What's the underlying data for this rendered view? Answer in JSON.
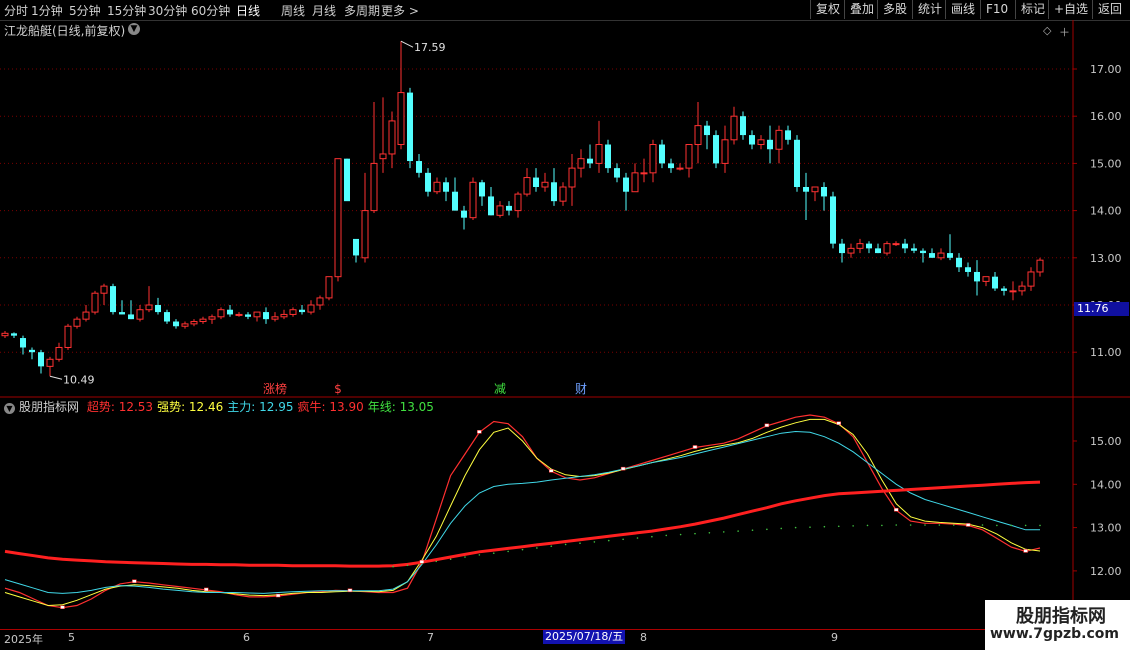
{
  "period_tabs": [
    "分时",
    "1分钟",
    "5分钟",
    "15分钟",
    "30分钟",
    "60分钟",
    "日线",
    "周线",
    "月线",
    "多周期",
    "更多 >"
  ],
  "active_period": "日线",
  "toolbar": [
    "复权",
    "叠加",
    "多股",
    "统计",
    "画线",
    "F10",
    "标记",
    "+自选",
    "返回"
  ],
  "chart_title": "江龙船艇(日线,前复权)",
  "main_axis_ticks": [
    "17.00",
    "16.00",
    "15.00",
    "14.00",
    "13.00",
    "12.00",
    "11.00"
  ],
  "current_price": "11.76",
  "high_label": "17.59",
  "low_label": "10.49",
  "event_markers": [
    {
      "label": "涨榜",
      "color": "#ff4040"
    },
    {
      "label": "$",
      "color": "#ff4040"
    },
    {
      "label": "减",
      "color": "#40e040"
    },
    {
      "label": "财",
      "color": "#6fa0ff"
    }
  ],
  "indicator": {
    "name": "股朋指标网",
    "items": [
      {
        "label": "超势: 12.53",
        "color": "#ff3030"
      },
      {
        "label": "强势: 12.46",
        "color": "#ffff40"
      },
      {
        "label": "主力: 12.95",
        "color": "#40d8e8"
      },
      {
        "label": "疯牛: 13.90",
        "color": "#ff3030"
      },
      {
        "label": "年线: 13.05",
        "color": "#40e040"
      }
    ]
  },
  "ind_axis_ticks": [
    "15.00",
    "14.00",
    "13.00",
    "12.00"
  ],
  "dates": [
    "2025年",
    "5",
    "6",
    "7",
    "8",
    "9"
  ],
  "cursor_date": "2025/07/18/五",
  "watermark": {
    "title": "股朋指标网",
    "url": "www.7gpzb.com"
  },
  "colors": {
    "up": "#ff3232",
    "down": "#54ffff",
    "bg": "#000000",
    "grid": "#8b0000"
  },
  "candles": [
    [
      11.35,
      11.45,
      11.3,
      11.4
    ],
    [
      11.4,
      11.42,
      11.3,
      11.35
    ],
    [
      11.3,
      11.35,
      10.95,
      11.1
    ],
    [
      11.05,
      11.1,
      10.85,
      11.0
    ],
    [
      11.0,
      11.05,
      10.55,
      10.7
    ],
    [
      10.7,
      10.9,
      10.49,
      10.85
    ],
    [
      10.85,
      11.2,
      10.8,
      11.1
    ],
    [
      11.1,
      11.6,
      11.05,
      11.55
    ],
    [
      11.55,
      11.75,
      11.5,
      11.7
    ],
    [
      11.7,
      12.0,
      11.65,
      11.85
    ],
    [
      11.85,
      12.3,
      11.8,
      12.25
    ],
    [
      12.25,
      12.45,
      12.0,
      12.4
    ],
    [
      12.4,
      12.45,
      11.8,
      11.85
    ],
    [
      11.85,
      12.1,
      11.8,
      11.8
    ],
    [
      11.8,
      12.1,
      11.7,
      11.7
    ],
    [
      11.7,
      12.0,
      11.65,
      11.9
    ],
    [
      11.9,
      12.4,
      11.85,
      12.0
    ],
    [
      12.0,
      12.15,
      11.8,
      11.85
    ],
    [
      11.85,
      11.9,
      11.6,
      11.65
    ],
    [
      11.65,
      11.7,
      11.5,
      11.55
    ],
    [
      11.55,
      11.65,
      11.5,
      11.6
    ],
    [
      11.6,
      11.7,
      11.55,
      11.65
    ],
    [
      11.65,
      11.75,
      11.6,
      11.7
    ],
    [
      11.7,
      11.8,
      11.6,
      11.75
    ],
    [
      11.75,
      11.95,
      11.7,
      11.9
    ],
    [
      11.9,
      12.0,
      11.75,
      11.8
    ],
    [
      11.8,
      11.85,
      11.75,
      11.8
    ],
    [
      11.8,
      11.85,
      11.7,
      11.75
    ],
    [
      11.75,
      11.85,
      11.65,
      11.85
    ],
    [
      11.85,
      11.95,
      11.6,
      11.7
    ],
    [
      11.7,
      11.85,
      11.65,
      11.75
    ],
    [
      11.75,
      11.9,
      11.7,
      11.8
    ],
    [
      11.8,
      11.95,
      11.75,
      11.9
    ],
    [
      11.9,
      12.0,
      11.8,
      11.85
    ],
    [
      11.85,
      12.1,
      11.8,
      12.0
    ],
    [
      12.0,
      12.2,
      11.9,
      12.15
    ],
    [
      12.15,
      12.6,
      12.1,
      12.6
    ],
    [
      12.6,
      15.1,
      12.5,
      15.1
    ],
    [
      15.1,
      15.1,
      14.3,
      14.2
    ],
    [
      13.4,
      13.2,
      12.9,
      13.05
    ],
    [
      13.0,
      14.8,
      12.9,
      14.0
    ],
    [
      14.0,
      16.3,
      13.95,
      15.0
    ],
    [
      15.1,
      16.4,
      14.8,
      15.2
    ],
    [
      15.2,
      16.1,
      14.9,
      15.9
    ],
    [
      15.4,
      17.59,
      15.3,
      16.5
    ],
    [
      16.5,
      16.6,
      14.9,
      15.05
    ],
    [
      15.05,
      15.2,
      14.7,
      14.8
    ],
    [
      14.8,
      14.9,
      14.3,
      14.4
    ],
    [
      14.4,
      14.7,
      14.35,
      14.6
    ],
    [
      14.6,
      14.7,
      14.2,
      14.4
    ],
    [
      14.4,
      14.7,
      14.0,
      14.0
    ],
    [
      14.0,
      14.1,
      13.6,
      13.85
    ],
    [
      13.85,
      14.7,
      13.8,
      14.6
    ],
    [
      14.6,
      14.65,
      14.1,
      14.3
    ],
    [
      14.3,
      14.5,
      13.9,
      13.9
    ],
    [
      13.9,
      14.2,
      13.85,
      14.1
    ],
    [
      14.1,
      14.2,
      13.9,
      14.0
    ],
    [
      14.0,
      14.4,
      13.85,
      14.35
    ],
    [
      14.35,
      14.9,
      14.3,
      14.7
    ],
    [
      14.7,
      14.9,
      14.4,
      14.5
    ],
    [
      14.5,
      14.8,
      14.4,
      14.6
    ],
    [
      14.6,
      14.9,
      14.1,
      14.2
    ],
    [
      14.2,
      14.6,
      14.1,
      14.5
    ],
    [
      14.5,
      15.2,
      14.1,
      14.9
    ],
    [
      14.9,
      15.3,
      14.7,
      15.1
    ],
    [
      15.1,
      15.4,
      14.9,
      15.0
    ],
    [
      15.0,
      15.9,
      14.8,
      15.4
    ],
    [
      15.4,
      15.5,
      14.8,
      14.9
    ],
    [
      14.9,
      15.0,
      14.6,
      14.7
    ],
    [
      14.7,
      14.8,
      14.0,
      14.4
    ],
    [
      14.4,
      15.0,
      14.4,
      14.8
    ],
    [
      14.8,
      15.1,
      14.6,
      14.8
    ],
    [
      14.8,
      15.5,
      14.6,
      15.4
    ],
    [
      15.4,
      15.5,
      14.9,
      15.0
    ],
    [
      15.0,
      15.1,
      14.8,
      14.9
    ],
    [
      14.9,
      15.0,
      14.85,
      14.9
    ],
    [
      14.9,
      15.4,
      14.7,
      15.4
    ],
    [
      15.4,
      16.3,
      15.0,
      15.8
    ],
    [
      15.8,
      15.9,
      15.3,
      15.6
    ],
    [
      15.6,
      15.7,
      14.9,
      15.0
    ],
    [
      15.0,
      15.8,
      14.8,
      15.5
    ],
    [
      15.5,
      16.2,
      15.4,
      16.0
    ],
    [
      16.0,
      16.1,
      15.5,
      15.6
    ],
    [
      15.6,
      15.7,
      15.3,
      15.4
    ],
    [
      15.4,
      15.6,
      15.3,
      15.5
    ],
    [
      15.5,
      15.8,
      15.0,
      15.3
    ],
    [
      15.3,
      15.8,
      15.0,
      15.7
    ],
    [
      15.7,
      15.8,
      15.4,
      15.5
    ],
    [
      15.5,
      15.6,
      14.4,
      14.5
    ],
    [
      14.5,
      14.8,
      13.8,
      14.4
    ],
    [
      14.4,
      14.5,
      14.2,
      14.5
    ],
    [
      14.5,
      14.6,
      14.0,
      14.3
    ],
    [
      14.3,
      14.4,
      13.2,
      13.3
    ],
    [
      13.3,
      13.4,
      12.9,
      13.1
    ],
    [
      13.1,
      13.3,
      13.0,
      13.2
    ],
    [
      13.2,
      13.4,
      13.1,
      13.3
    ],
    [
      13.3,
      13.35,
      13.1,
      13.2
    ],
    [
      13.2,
      13.3,
      13.1,
      13.1
    ],
    [
      13.1,
      13.35,
      13.05,
      13.3
    ],
    [
      13.3,
      13.35,
      13.25,
      13.3
    ],
    [
      13.3,
      13.4,
      13.1,
      13.2
    ],
    [
      13.2,
      13.3,
      13.1,
      13.15
    ],
    [
      13.15,
      13.2,
      12.9,
      13.1
    ],
    [
      13.1,
      13.2,
      13.0,
      13.0
    ],
    [
      13.0,
      13.2,
      12.95,
      13.1
    ],
    [
      13.1,
      13.5,
      12.95,
      13.0
    ],
    [
      13.0,
      13.1,
      12.7,
      12.8
    ],
    [
      12.8,
      12.9,
      12.6,
      12.7
    ],
    [
      12.7,
      12.95,
      12.2,
      12.5
    ],
    [
      12.5,
      12.6,
      12.4,
      12.6
    ],
    [
      12.6,
      12.7,
      12.3,
      12.35
    ],
    [
      12.35,
      12.4,
      12.2,
      12.3
    ],
    [
      12.3,
      12.5,
      12.1,
      12.3
    ],
    [
      12.3,
      12.5,
      12.2,
      12.4
    ],
    [
      12.4,
      12.8,
      12.3,
      12.7
    ],
    [
      12.7,
      13.0,
      12.6,
      12.95
    ]
  ],
  "indicator_series": {
    "超势": [
      11.6,
      11.5,
      11.35,
      11.2,
      11.15,
      11.2,
      11.35,
      11.55,
      11.7,
      11.75,
      11.72,
      11.68,
      11.64,
      11.6,
      11.56,
      11.52,
      11.45,
      11.4,
      11.4,
      11.42,
      11.46,
      11.5,
      11.52,
      11.55,
      11.54,
      11.52,
      11.5,
      11.5,
      11.6,
      12.2,
      13.2,
      14.2,
      14.7,
      15.2,
      15.45,
      15.4,
      15.1,
      14.6,
      14.3,
      14.15,
      14.1,
      14.15,
      14.25,
      14.35,
      14.45,
      14.55,
      14.65,
      14.75,
      14.85,
      14.9,
      14.95,
      15.05,
      15.2,
      15.35,
      15.45,
      15.55,
      15.6,
      15.55,
      15.4,
      15.1,
      14.5,
      13.9,
      13.4,
      13.15,
      13.1,
      13.1,
      13.08,
      13.05,
      12.95,
      12.75,
      12.55,
      12.45,
      12.53
    ],
    "强势": [
      11.5,
      11.4,
      11.3,
      11.2,
      11.22,
      11.32,
      11.45,
      11.58,
      11.65,
      11.68,
      11.66,
      11.63,
      11.6,
      11.55,
      11.52,
      11.5,
      11.47,
      11.44,
      11.43,
      11.45,
      11.48,
      11.5,
      11.5,
      11.52,
      11.53,
      11.53,
      11.52,
      11.55,
      11.75,
      12.25,
      12.8,
      13.5,
      14.2,
      14.8,
      15.2,
      15.3,
      15.0,
      14.6,
      14.35,
      14.22,
      14.18,
      14.2,
      14.26,
      14.34,
      14.42,
      14.5,
      14.58,
      14.66,
      14.76,
      14.84,
      14.9,
      14.96,
      15.06,
      15.2,
      15.32,
      15.42,
      15.5,
      15.5,
      15.38,
      15.15,
      14.7,
      14.1,
      13.55,
      13.25,
      13.15,
      13.12,
      13.1,
      13.08,
      13.0,
      12.85,
      12.65,
      12.5,
      12.46
    ],
    "主力": [
      11.8,
      11.7,
      11.6,
      11.5,
      11.48,
      11.5,
      11.55,
      11.62,
      11.66,
      11.65,
      11.62,
      11.58,
      11.55,
      11.52,
      11.5,
      11.5,
      11.5,
      11.49,
      11.48,
      11.5,
      11.52,
      11.53,
      11.54,
      11.54,
      11.54,
      11.54,
      11.54,
      11.58,
      11.75,
      12.15,
      12.6,
      13.1,
      13.5,
      13.8,
      13.95,
      14.0,
      14.02,
      14.05,
      14.1,
      14.14,
      14.18,
      14.22,
      14.28,
      14.35,
      14.42,
      14.5,
      14.56,
      14.62,
      14.7,
      14.78,
      14.86,
      14.94,
      15.02,
      15.1,
      15.18,
      15.22,
      15.2,
      15.1,
      14.95,
      14.75,
      14.5,
      14.25,
      14.0,
      13.8,
      13.65,
      13.55,
      13.45,
      13.35,
      13.25,
      13.15,
      13.05,
      12.95,
      12.95
    ],
    "疯牛": [
      12.45,
      12.4,
      12.35,
      12.3,
      12.27,
      12.25,
      12.23,
      12.21,
      12.2,
      12.19,
      12.18,
      12.17,
      12.16,
      12.15,
      12.15,
      12.14,
      12.14,
      12.13,
      12.13,
      12.13,
      12.12,
      12.12,
      12.12,
      12.12,
      12.11,
      12.11,
      12.11,
      12.12,
      12.15,
      12.2,
      12.26,
      12.32,
      12.38,
      12.44,
      12.48,
      12.52,
      12.56,
      12.6,
      12.64,
      12.68,
      12.72,
      12.76,
      12.8,
      12.84,
      12.88,
      12.92,
      12.97,
      13.02,
      13.08,
      13.15,
      13.22,
      13.3,
      13.38,
      13.46,
      13.55,
      13.62,
      13.68,
      13.74,
      13.78,
      13.8,
      13.82,
      13.84,
      13.86,
      13.88,
      13.9,
      13.92,
      13.94,
      13.96,
      13.98,
      14.0,
      14.02,
      14.04,
      14.05
    ],
    "年线": [
      null,
      null,
      null,
      null,
      null,
      null,
      null,
      null,
      null,
      null,
      null,
      null,
      null,
      null,
      null,
      null,
      null,
      null,
      null,
      null,
      null,
      null,
      null,
      null,
      null,
      null,
      null,
      12.1,
      12.13,
      12.17,
      12.22,
      12.27,
      12.32,
      12.37,
      12.41,
      12.45,
      12.49,
      12.53,
      12.57,
      12.61,
      12.64,
      12.67,
      12.7,
      12.73,
      12.76,
      12.79,
      12.82,
      12.84,
      12.86,
      12.88,
      12.9,
      12.92,
      12.94,
      12.96,
      12.98,
      13.0,
      13.01,
      13.02,
      13.03,
      13.04,
      13.05,
      13.05,
      13.06,
      13.06,
      13.06,
      13.06,
      13.06,
      13.06,
      13.06,
      13.05,
      13.05,
      13.05,
      13.05
    ]
  }
}
